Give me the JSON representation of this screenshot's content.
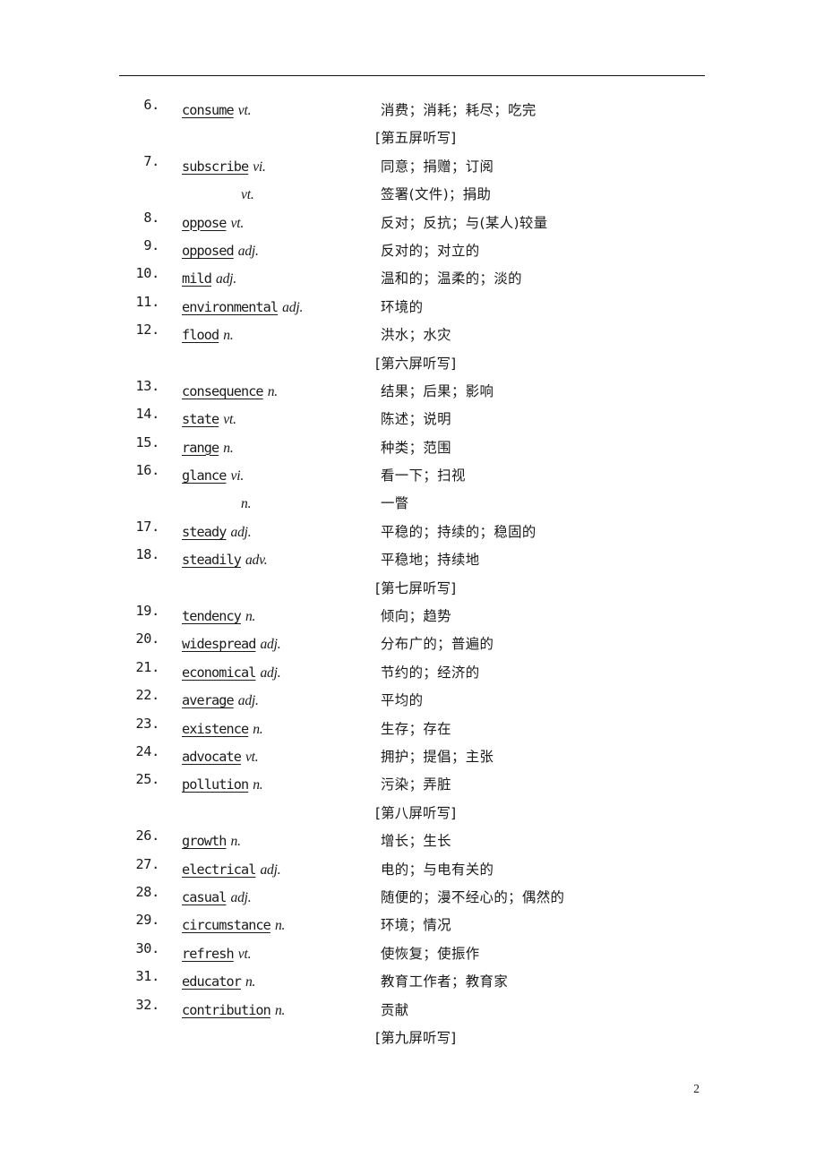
{
  "page": {
    "number": "2"
  },
  "entries": [
    {
      "num": "6.",
      "word": "consume",
      "pos": "vt.",
      "gloss": "消费；消耗；耗尽；吃完"
    },
    {
      "num": "",
      "word": "",
      "pos": "",
      "gloss": "[第五屏听写]",
      "marker": true
    },
    {
      "num": "7.",
      "word": "subscribe",
      "pos": "vi.",
      "gloss": "同意；捐赠；订阅"
    },
    {
      "num": "",
      "word": "",
      "pos": "vt.",
      "gloss": "签署(文件)；捐助",
      "cont": true
    },
    {
      "num": "8.",
      "word": "oppose",
      "pos": "vt.",
      "gloss": "反对；反抗；与(某人)较量"
    },
    {
      "num": "9.",
      "word": "opposed",
      "pos": "adj.",
      "gloss": "反对的；对立的"
    },
    {
      "num": "10.",
      "word": "mild",
      "pos": "adj.",
      "gloss": "温和的；温柔的；淡的"
    },
    {
      "num": "11.",
      "word": "environmental",
      "pos": "adj.",
      "gloss": "环境的"
    },
    {
      "num": "12.",
      "word": "flood",
      "pos": "n.",
      "gloss": "洪水；水灾"
    },
    {
      "num": "",
      "word": "",
      "pos": "",
      "gloss": "[第六屏听写]",
      "marker": true
    },
    {
      "num": "13.",
      "word": "consequence",
      "pos": "n.",
      "gloss": "结果；后果；影响"
    },
    {
      "num": "14.",
      "word": "state",
      "pos": "vt.",
      "gloss": "陈述；说明"
    },
    {
      "num": "15.",
      "word": "range",
      "pos": "n.",
      "gloss": "种类；范围"
    },
    {
      "num": "16.",
      "word": "glance",
      "pos": "vi.",
      "gloss": "看一下；扫视"
    },
    {
      "num": "",
      "word": "",
      "pos": "n.",
      "gloss": "一瞥",
      "cont": true
    },
    {
      "num": "17.",
      "word": "steady",
      "pos": "adj.",
      "gloss": "平稳的；持续的；稳固的"
    },
    {
      "num": "18.",
      "word": "steadily",
      "pos": "adv.",
      "gloss": "平稳地；持续地"
    },
    {
      "num": "",
      "word": "",
      "pos": "",
      "gloss": "[第七屏听写]",
      "marker": true
    },
    {
      "num": "19.",
      "word": "tendency",
      "pos": "n.",
      "gloss": "倾向；趋势"
    },
    {
      "num": "20.",
      "word": "widespread",
      "pos": "adj.",
      "gloss": "分布广的；普遍的"
    },
    {
      "num": "21.",
      "word": "economical",
      "pos": "adj.",
      "gloss": "节约的；经济的"
    },
    {
      "num": "22.",
      "word": "average",
      "pos": "adj.",
      "gloss": "平均的"
    },
    {
      "num": "23.",
      "word": "existence",
      "pos": "n.",
      "gloss": "生存；存在"
    },
    {
      "num": "24.",
      "word": "advocate",
      "pos": "vt.",
      "gloss": "拥护；提倡；主张"
    },
    {
      "num": "25.",
      "word": "pollution",
      "pos": "n.",
      "gloss": "污染；弄脏"
    },
    {
      "num": "",
      "word": "",
      "pos": "",
      "gloss": "[第八屏听写]",
      "marker": true
    },
    {
      "num": "26.",
      "word": "growth",
      "pos": "n.",
      "gloss": "增长；生长"
    },
    {
      "num": "27.",
      "word": "electrical",
      "pos": "adj.",
      "gloss": "电的；与电有关的"
    },
    {
      "num": "28.",
      "word": "casual",
      "pos": "adj.",
      "gloss": "随便的；漫不经心的；偶然的"
    },
    {
      "num": "29.",
      "word": "circumstance",
      "pos": "n.",
      "gloss": "环境；情况"
    },
    {
      "num": "30.",
      "word": "refresh",
      "pos": "vt.",
      "gloss": "使恢复；使振作"
    },
    {
      "num": "31.",
      "word": "educator",
      "pos": "n.",
      "gloss": "教育工作者；教育家"
    },
    {
      "num": "32.",
      "word": "contribution",
      "pos": "n.",
      "gloss": "贡献"
    },
    {
      "num": "",
      "word": "",
      "pos": "",
      "gloss": "[第九屏听写]",
      "marker": true
    }
  ]
}
